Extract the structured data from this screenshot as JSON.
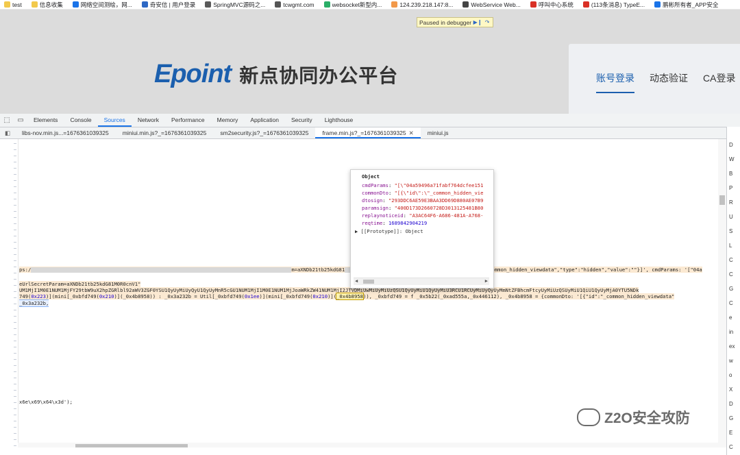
{
  "bookmarks": [
    {
      "label": "test",
      "color": "#f2c94c"
    },
    {
      "label": "信息收集",
      "color": "#f2c94c"
    },
    {
      "label": "网络空间测绘，网...",
      "color": "#1a73e8"
    },
    {
      "label": "奇安信 | 用户登录",
      "color": "#2d68c4"
    },
    {
      "label": "SpringMVC源码之...",
      "color": "#5a5a5a"
    },
    {
      "label": "tcwgmt.com",
      "color": "#555555"
    },
    {
      "label": "websocket新型内...",
      "color": "#2aae67"
    },
    {
      "label": "124.239.218.147:8...",
      "color": "#f2994a"
    },
    {
      "label": "WebService Web...",
      "color": "#444444"
    },
    {
      "label": "呼叫中心系统",
      "color": "#d93025"
    },
    {
      "label": "(113条消息) TypeE...",
      "color": "#d93025"
    },
    {
      "label": "鹏彬所有者_APP安全",
      "color": "#1a73e8"
    }
  ],
  "page": {
    "debugger_banner": "Paused in debugger",
    "resume_icon": "resume-icon",
    "step_icon": "step-over-icon",
    "brand": "Epoint",
    "title": "新点协同办公平台",
    "login_tabs": [
      "账号登录",
      "动态验证",
      "CA登录"
    ]
  },
  "devtools": {
    "tabs": [
      "Elements",
      "Console",
      "Sources",
      "Network",
      "Performance",
      "Memory",
      "Application",
      "Security",
      "Lighthouse"
    ],
    "active_tab": "Sources",
    "file_tabs": [
      "libs-nov.min.js...=1676361039325",
      "miniui.min.js?_=1676361039325",
      "sm2security.js?_=1676361039325",
      "frame.min.js?_=1676361039325",
      "miniui.js"
    ],
    "active_file_tab": "frame.min.js?_=1676361039325",
    "code": {
      "line1_prefix": "ps:/",
      "line1_mid": "m=aXNDb21tb25kdG81",
      "line1_end": "common_hidden_viewdata\",\"type\":\"hidden\",\"value\":\"\"}]', cmdParams: '[\"04a",
      "line2": "eUrlSecretParam=aXNDb21tb25kdG81M0R0cnV1\"",
      "line3": "UM1MjI1M0E1NUM1MjFY29tbW9uX2hpZGRlbl92aWV3ZGF0YSU1QyUyMiUyQyU1QyUyMnR5cGU1NUM1MjI1M0E1NUM1MjJoaWRkZW41NUM1MjI2JTVDMiUwMiUyMiUzQSU1QyUyMiU1QyUyMiU3RCU1RCUyMiUyQyUyMmNtZFBhcmFtcyUyMiUzQSUyMiU1QiU1QyUyMjA0YTU5NDk",
      "line4_a": "749(",
      "line4_n1": "0x223",
      "line4_b": ")](mini[_0xbfd749(",
      "line4_n2": "0x210",
      "line4_c": ")](_0x4b8958)) : _0x3a232b = Util[_0xbfd749(",
      "line4_n3": "0x1ee",
      "line4_d": ")](mini[_0xbfd749(",
      "line4_n4": "0x210",
      "line4_e": ")](",
      "line4_box": "_0x4b8958",
      "line4_f": ")),  _0xbfd749 = f _0x5b22(_0xad555a,_0x446112), _0x4b8958 = {commonDto: '[{\"id\":\"_common_hidden_viewdata\"",
      "line5": "_0x3a232b,",
      "line6": "x6e\\x69\\x64\\x3d');"
    },
    "popover": {
      "title": "Object",
      "props": [
        {
          "key": "cmdParams",
          "value": "\"[\\\"04a59496a71fabf764dcfee151"
        },
        {
          "key": "commonDto",
          "value": "\"[{\\\"id\\\":\\\"_common_hidden_vie"
        },
        {
          "key": "dtosign",
          "value": "\"293DDC6AE59E3BAA3DD69D880AE07B9"
        },
        {
          "key": "paramsign",
          "value": "\"400D173D2660728D3013125481B80"
        },
        {
          "key": "replaynoticeid",
          "value": "\"A3AC64F6-A686-481A-A768-"
        },
        {
          "key": "reqtime",
          "value": "1689842904219"
        }
      ],
      "prototype": "[[Prototype]]: Object"
    },
    "side_labels": [
      "D",
      "W",
      "B",
      "P",
      "R",
      "U",
      "S",
      "L",
      "C",
      "C",
      "G",
      "C",
      "e",
      "in",
      "ex",
      "w",
      "o",
      "X",
      "D",
      "G",
      "E",
      "C"
    ]
  },
  "watermark": "Z2O安全攻防",
  "colors": {
    "accent": "#1a73e8",
    "brand": "#1b5fae"
  }
}
